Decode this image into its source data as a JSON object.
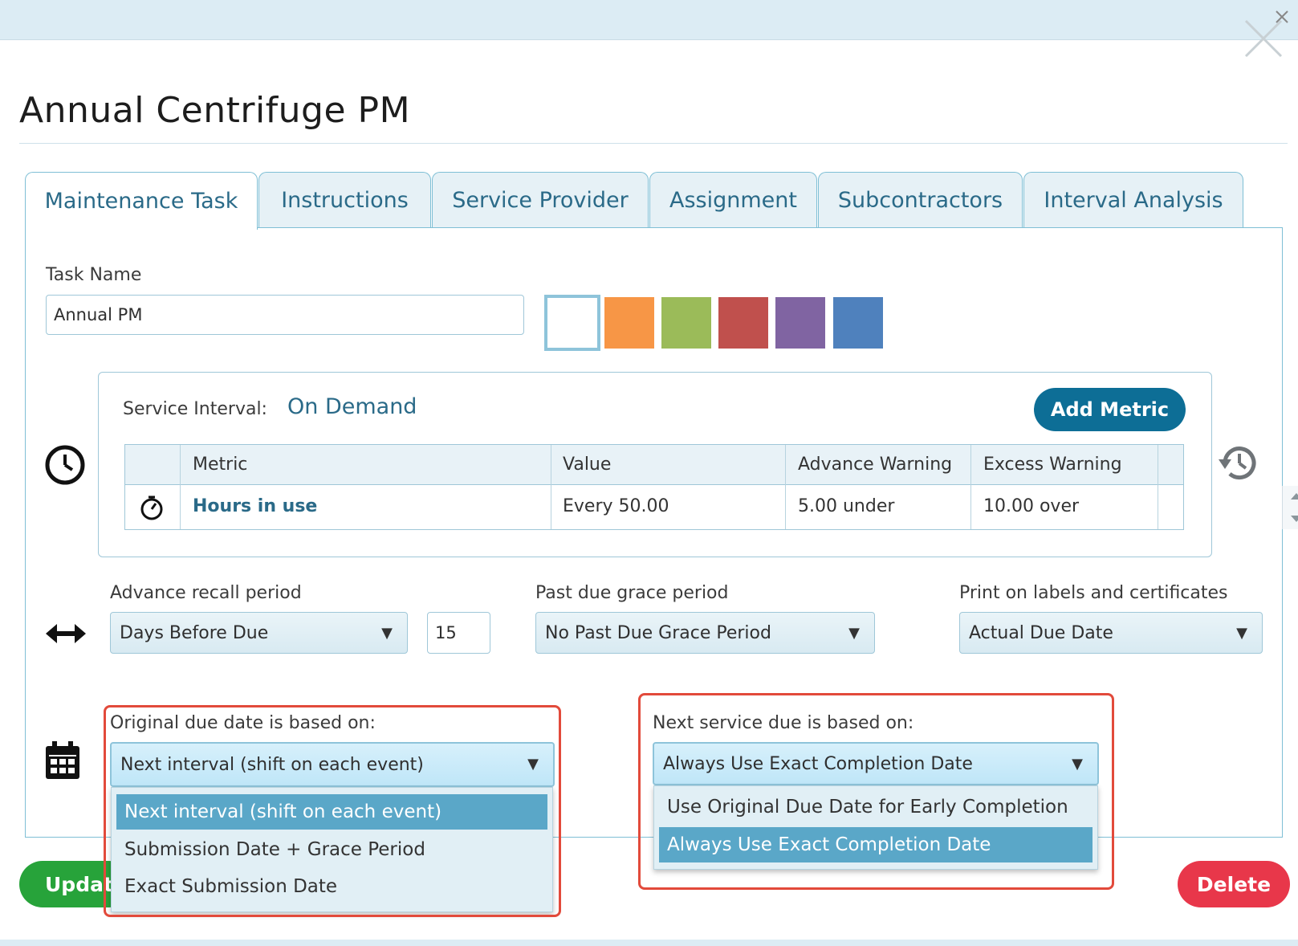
{
  "dialog": {
    "title": "Annual Centrifuge PM"
  },
  "tabs": [
    {
      "label": "Maintenance Task",
      "active": true
    },
    {
      "label": "Instructions"
    },
    {
      "label": "Service Provider"
    },
    {
      "label": "Assignment"
    },
    {
      "label": "Subcontractors"
    },
    {
      "label": "Interval Analysis"
    }
  ],
  "task": {
    "name_label": "Task Name",
    "name_value": "Annual PM",
    "colors": [
      "#ffffff",
      "#f79646",
      "#9bbb59",
      "#c0504d",
      "#8064a2",
      "#4f81bd"
    ],
    "selected_color": "#ffffff"
  },
  "service_interval": {
    "label": "Service Interval:",
    "value": "On Demand",
    "add_metric_label": "Add Metric",
    "columns": [
      "Metric",
      "Value",
      "Advance Warning",
      "Excess Warning"
    ],
    "rows": [
      {
        "icon": "timer-icon",
        "metric": "Hours in use",
        "value": "Every 50.00",
        "advance": "5.00 under",
        "excess": "10.00 over"
      }
    ]
  },
  "recall": {
    "advance_label": "Advance recall period",
    "advance_value": "Days Before Due",
    "advance_days": "15",
    "grace_label": "Past due grace period",
    "grace_value": "No Past Due Grace Period",
    "print_label": "Print on labels and certificates",
    "print_value": "Actual Due Date"
  },
  "original_due": {
    "label": "Original due date is based on:",
    "value": "Next interval (shift on each event)",
    "options": [
      "Next interval (shift on each event)",
      "Submission Date + Grace Period",
      "Exact Submission Date"
    ]
  },
  "next_service": {
    "label": "Next service due is based on:",
    "value": "Always Use Exact Completion Date",
    "options": [
      "Use Original Due Date for Early Completion",
      "Always Use Exact Completion Date"
    ]
  },
  "footer": {
    "update_label": "Update",
    "delete_label": "Delete"
  },
  "colors": {
    "accent": "#0d6e96",
    "update": "#27a33a",
    "delete": "#e8374a",
    "highlight": "#e24a3b"
  }
}
